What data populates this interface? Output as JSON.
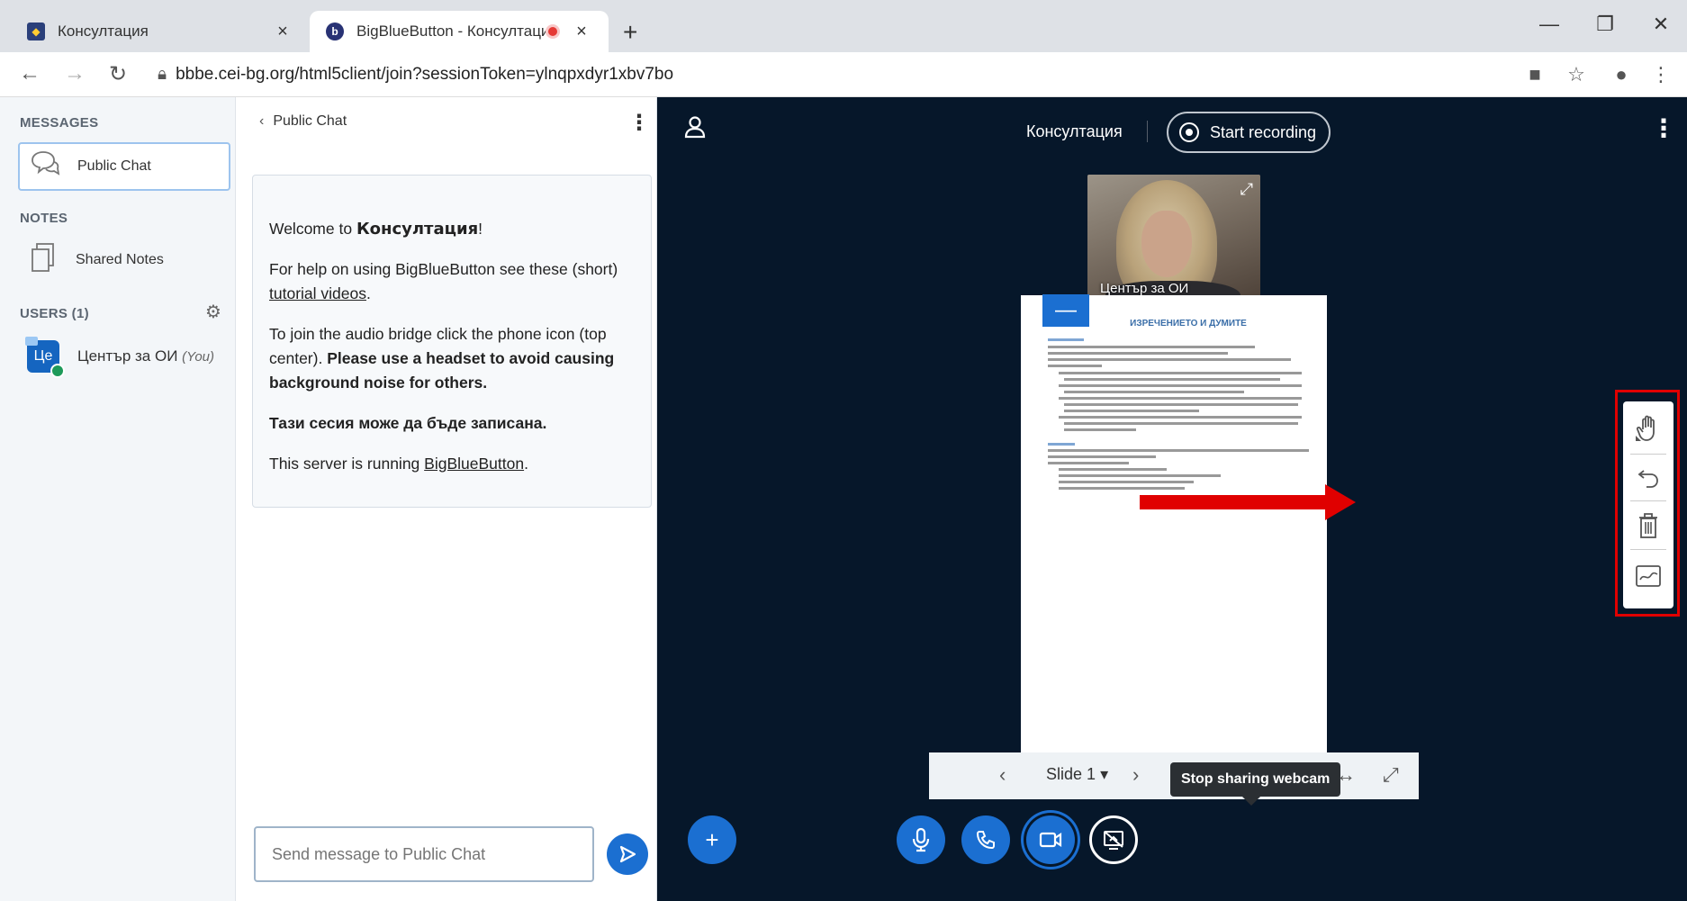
{
  "browser": {
    "tabs": [
      {
        "title": "Консултация",
        "close": "×"
      },
      {
        "title": "BigBlueButton - Консултаци",
        "close": "×"
      }
    ],
    "new_tab": "+",
    "window_controls": {
      "minimize": "—",
      "restore": "❐",
      "close": "✕"
    },
    "nav": {
      "back": "←",
      "forward": "→",
      "reload": "↻"
    },
    "url": "bbbe.cei-bg.org/html5client/join?sessionToken=ylnqpxdyr1xbv7bo",
    "icons": [
      "camera-icon",
      "star-icon",
      "profile-icon",
      "menu-icon"
    ]
  },
  "sidebar": {
    "messages_title": "MESSAGES",
    "public_chat": "Public Chat",
    "notes_title": "NOTES",
    "shared_notes": "Shared Notes",
    "users_title": "USERS (1)",
    "user": {
      "initials": "Це",
      "name": "Център за ОИ",
      "you": "(You)"
    }
  },
  "chat": {
    "header": "Public Chat",
    "welcome": {
      "line1_pre": "Welcome to ",
      "room": "Консултация",
      "line1_post": "!",
      "help_pre": "For help on using BigBlueButton see these (short) ",
      "help_link": "tutorial videos",
      "help_post": ".",
      "audio_pre": "To join the audio bridge click the phone icon (top center). ",
      "audio_bold": "Please use a headset to avoid causing background noise for others.",
      "recorded": "Тази сесия може да бъде записана.",
      "server_pre": "This server is running ",
      "server_link": "BigBlueButton",
      "server_post": "."
    },
    "input_placeholder": "Send message to Public Chat"
  },
  "main": {
    "meeting_title": "Консултация",
    "record_label": "Start recording",
    "webcam_name": "Център за ОИ",
    "slide_title": "ИЗРЕЧЕНИЕТО И ДУМИТЕ",
    "slide_label": "Slide 1",
    "slide_dropdown": "▾",
    "tooltip": "Stop sharing webcam"
  },
  "colors": {
    "accent": "#1b6fd1",
    "main_bg": "#06172a",
    "highlight": "#e00000"
  }
}
